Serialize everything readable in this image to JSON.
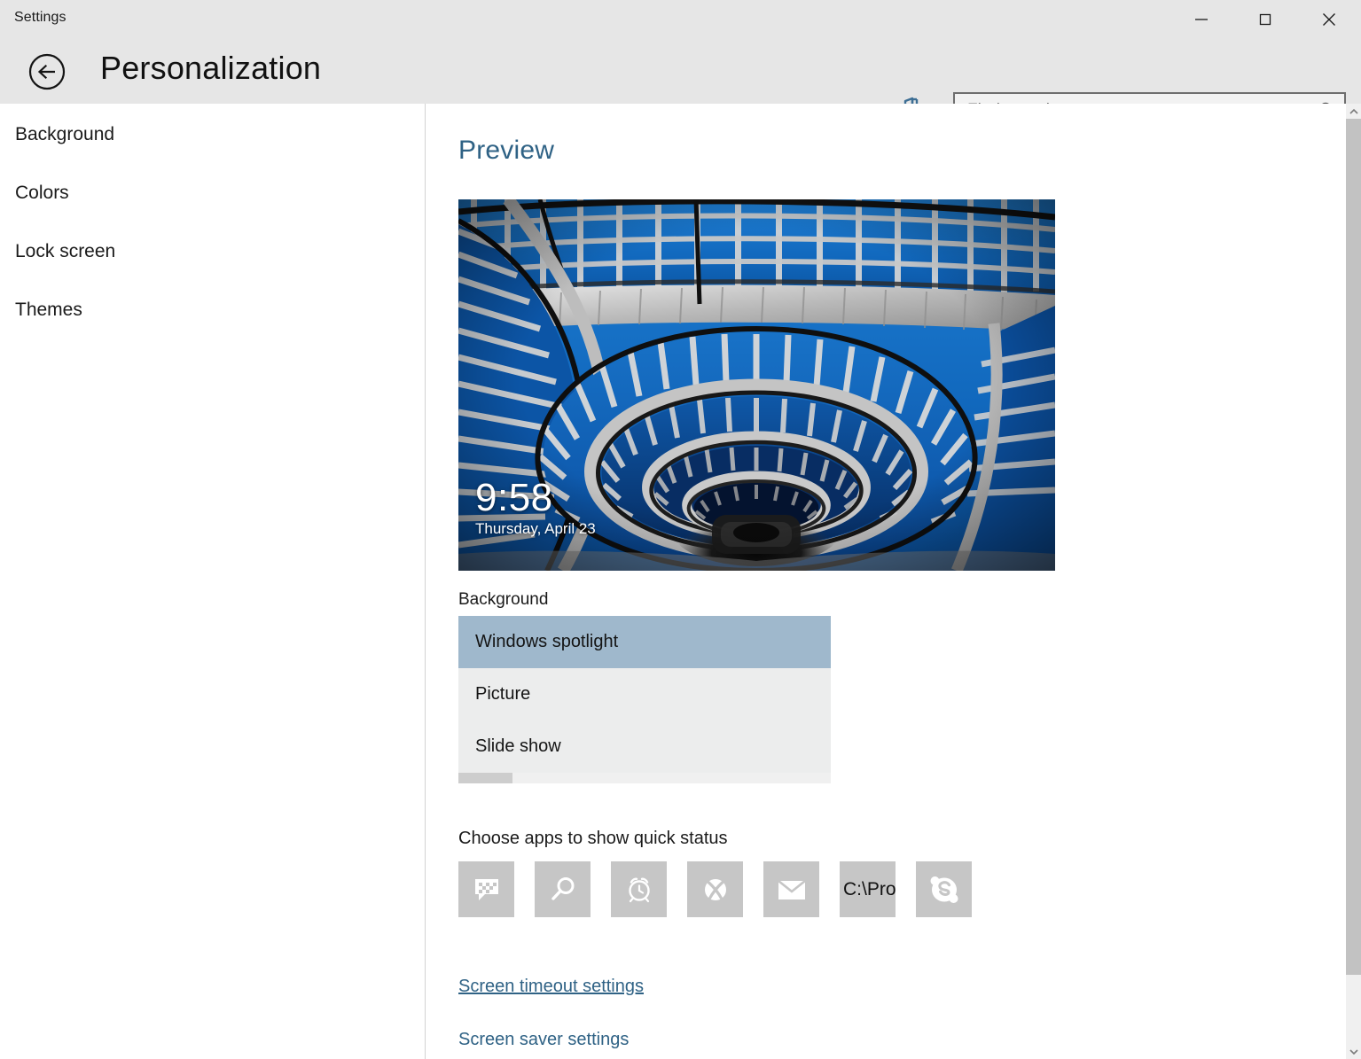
{
  "window": {
    "title": "Settings",
    "minimize_label": "Minimize",
    "maximize_label": "Maximize",
    "close_label": "Close"
  },
  "header": {
    "back_label": "Back",
    "page_title": "Personalization",
    "pin_label": "Pin to Start"
  },
  "search": {
    "placeholder": "Find a setting",
    "value": "",
    "icon": "search-icon"
  },
  "sidebar": {
    "items": [
      {
        "label": "Background"
      },
      {
        "label": "Colors"
      },
      {
        "label": "Lock screen"
      },
      {
        "label": "Themes"
      }
    ]
  },
  "main": {
    "section_title": "Preview",
    "lock_preview": {
      "time": "9:58",
      "date": "Thursday, April 23",
      "image_alt": "Blue spiral staircase lock screen background"
    },
    "background": {
      "label": "Background",
      "selected": "Windows spotlight",
      "options": [
        {
          "label": "Windows spotlight",
          "selected": true
        },
        {
          "label": "Picture",
          "selected": false
        },
        {
          "label": "Slide show",
          "selected": false
        }
      ]
    },
    "quick_status": {
      "label": "Choose apps to show quick status",
      "tiles": [
        {
          "icon": "messaging-icon",
          "text": ""
        },
        {
          "icon": "search-icon",
          "text": ""
        },
        {
          "icon": "alarm-clock-icon",
          "text": ""
        },
        {
          "icon": "xbox-icon",
          "text": ""
        },
        {
          "icon": "mail-icon",
          "text": ""
        },
        {
          "icon": "text-tile",
          "text": "C:\\Pro"
        },
        {
          "icon": "skype-icon",
          "text": ""
        }
      ]
    },
    "links": [
      {
        "label": "Screen timeout settings",
        "hovered": true
      },
      {
        "label": "Screen saver settings",
        "hovered": false
      }
    ]
  },
  "colors": {
    "chrome": "#e6e6e6",
    "accent_text": "#2f6285",
    "selection": "#9fb8cc",
    "tile": "#c6c6c6",
    "dropdown_bg": "#eceded"
  }
}
